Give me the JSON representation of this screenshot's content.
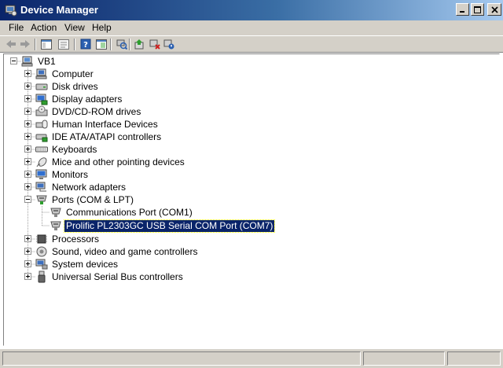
{
  "window": {
    "title": "Device Manager"
  },
  "menu": [
    "File",
    "Action",
    "View",
    "Help"
  ],
  "toolbar_icons": [
    "back-arrow-icon",
    "forward-arrow-icon",
    "show-hide-tree-icon",
    "properties-icon",
    "help-icon",
    "view-icon",
    "scan-hardware-icon",
    "update-driver-icon",
    "uninstall-icon",
    "disable-icon"
  ],
  "tree": {
    "root": "VB1",
    "categories": [
      {
        "label": "Computer",
        "icon": "computer-icon",
        "expanded": false
      },
      {
        "label": "Disk drives",
        "icon": "disk-drive-icon",
        "expanded": false
      },
      {
        "label": "Display adapters",
        "icon": "display-adapter-icon",
        "expanded": false
      },
      {
        "label": "DVD/CD-ROM drives",
        "icon": "dvd-drive-icon",
        "expanded": false
      },
      {
        "label": "Human Interface Devices",
        "icon": "hid-icon",
        "expanded": false
      },
      {
        "label": "IDE ATA/ATAPI controllers",
        "icon": "ide-controller-icon",
        "expanded": false
      },
      {
        "label": "Keyboards",
        "icon": "keyboard-icon",
        "expanded": false
      },
      {
        "label": "Mice and other pointing devices",
        "icon": "mouse-icon",
        "expanded": false
      },
      {
        "label": "Monitors",
        "icon": "monitor-icon",
        "expanded": false
      },
      {
        "label": "Network adapters",
        "icon": "network-adapter-icon",
        "expanded": false
      },
      {
        "label": "Ports (COM & LPT)",
        "icon": "port-icon",
        "expanded": true,
        "children": [
          {
            "label": "Communications Port (COM1)",
            "icon": "port-icon",
            "selected": false
          },
          {
            "label": "Prolific PL2303GC USB Serial COM Port (COM7)",
            "icon": "port-icon",
            "selected": true
          }
        ]
      },
      {
        "label": "Processors",
        "icon": "processor-icon",
        "expanded": false
      },
      {
        "label": "Sound, video and game controllers",
        "icon": "sound-icon",
        "expanded": false
      },
      {
        "label": "System devices",
        "icon": "system-device-icon",
        "expanded": false
      },
      {
        "label": "Universal Serial Bus controllers",
        "icon": "usb-icon",
        "expanded": false
      }
    ]
  },
  "colors": {
    "selection": "#0a246a",
    "chrome": "#d4d0c8"
  }
}
